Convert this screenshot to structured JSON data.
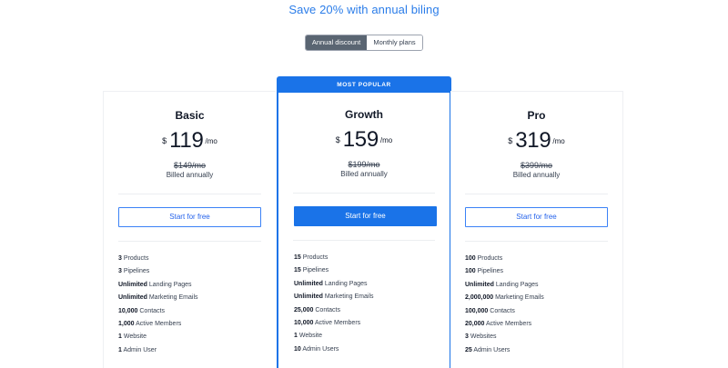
{
  "headline": "Save 20% with annual biling",
  "toggle": {
    "active_label": "Annual discount",
    "inactive_label": "Monthly plans"
  },
  "plans": [
    {
      "name": "Basic",
      "currency": "$",
      "price": "119",
      "period": "/mo",
      "old_price": "$149/mo",
      "billing_note": "Billed annually",
      "cta_label": "Start for free",
      "ribbon": "",
      "features": [
        {
          "value": "3",
          "label": " Products"
        },
        {
          "value": "3",
          "label": " Pipelines"
        },
        {
          "value": "Unlimited",
          "label": " Landing Pages"
        },
        {
          "value": "Unlimited",
          "label": " Marketing Emails"
        },
        {
          "value": "10,000",
          "label": " Contacts"
        },
        {
          "value": "1,000",
          "label": " Active Members"
        },
        {
          "value": "1",
          "label": " Website"
        },
        {
          "value": "1",
          "label": " Admin User"
        }
      ]
    },
    {
      "name": "Growth",
      "currency": "$",
      "price": "159",
      "period": "/mo",
      "old_price": "$199/mo",
      "billing_note": "Billed annually",
      "cta_label": "Start for free",
      "ribbon": "MOST POPULAR",
      "features": [
        {
          "value": "15",
          "label": " Products"
        },
        {
          "value": "15",
          "label": " Pipelines"
        },
        {
          "value": "Unlimited",
          "label": " Landing Pages"
        },
        {
          "value": "Unlimited",
          "label": " Marketing Emails"
        },
        {
          "value": "25,000",
          "label": " Contacts"
        },
        {
          "value": "10,000",
          "label": " Active Members"
        },
        {
          "value": "1",
          "label": " Website"
        },
        {
          "value": "10",
          "label": " Admin Users"
        }
      ]
    },
    {
      "name": "Pro",
      "currency": "$",
      "price": "319",
      "period": "/mo",
      "old_price": "$399/mo",
      "billing_note": "Billed annually",
      "cta_label": "Start for free",
      "ribbon": "",
      "features": [
        {
          "value": "100",
          "label": " Products"
        },
        {
          "value": "100",
          "label": " Pipelines"
        },
        {
          "value": "Unlimited",
          "label": " Landing Pages"
        },
        {
          "value": "2,000,000",
          "label": " Marketing Emails"
        },
        {
          "value": "100,000",
          "label": " Contacts"
        },
        {
          "value": "20,000",
          "label": " Active Members"
        },
        {
          "value": "3",
          "label": " Websites"
        },
        {
          "value": "25",
          "label": " Admin Users"
        }
      ]
    }
  ],
  "colors": {
    "accent": "#1a73e8",
    "headline": "#2b7de9",
    "toggle_active": "#5a6572"
  }
}
